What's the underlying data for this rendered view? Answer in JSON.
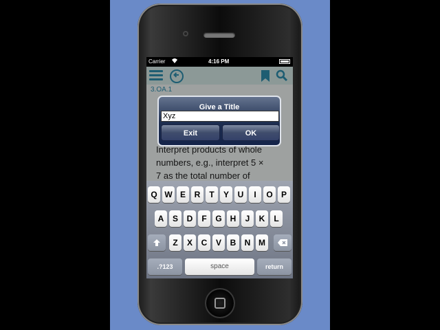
{
  "status_bar": {
    "carrier": "Carrier",
    "time": "4:16 PM"
  },
  "app_bar": {
    "icons": [
      "menu-icon",
      "back-icon",
      "bookmark-icon",
      "search-icon"
    ],
    "accent": "#2e8fb0"
  },
  "content": {
    "code": "3.OA.1",
    "lines": [
      "Interpret products of whole",
      "numbers, e.g., interpret 5 ×",
      "7 as the total number of"
    ]
  },
  "dialog": {
    "title": "Give a Title",
    "input_value": "Xyz",
    "exit_label": "Exit",
    "ok_label": "OK"
  },
  "keyboard": {
    "row1": [
      "Q",
      "W",
      "E",
      "R",
      "T",
      "Y",
      "U",
      "I",
      "O",
      "P"
    ],
    "row2": [
      "A",
      "S",
      "D",
      "F",
      "G",
      "H",
      "J",
      "K",
      "L"
    ],
    "row3": [
      "Z",
      "X",
      "C",
      "V",
      "B",
      "N",
      "M"
    ],
    "numbers_label": ".?123",
    "space_label": "space",
    "return_label": "return"
  }
}
